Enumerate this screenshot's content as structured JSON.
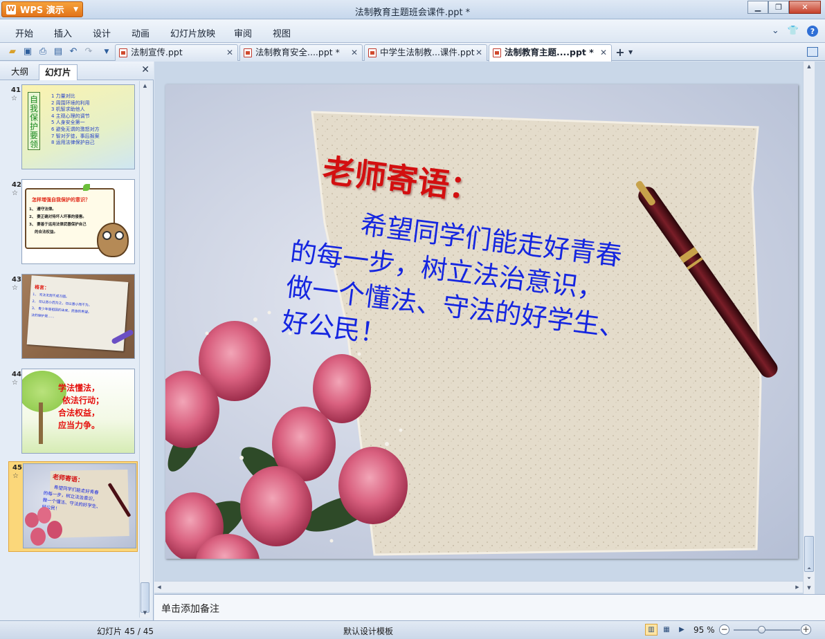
{
  "window": {
    "app_button": "WPS 演示",
    "title": "法制教育主题班会课件.ppt *"
  },
  "menu": [
    "开始",
    "插入",
    "设计",
    "动画",
    "幻灯片放映",
    "审阅",
    "视图"
  ],
  "tabs": [
    {
      "label": "法制宣传.ppt"
    },
    {
      "label": "法制教育安全....ppt *"
    },
    {
      "label": "中学生法制教...课件.ppt"
    },
    {
      "label": "法制教育主题....ppt *"
    }
  ],
  "left_pane": {
    "tab_outline": "大纲",
    "tab_slides": "幻灯片"
  },
  "slides": [
    {
      "number": "41",
      "title": "自我保护要领",
      "items": [
        "1 力量对比",
        "2 周围环境的利用",
        "3 机智求助他人",
        "4 主观心理的调节",
        "5 人身安全第一",
        "6 避免无谓的激怒对方",
        "7 智对歹徒，事后报案",
        "8 运用法律保护自己"
      ]
    },
    {
      "number": "42",
      "title": "怎样增强自我保护的意识？",
      "items": [
        "1、 遵守法律。",
        "2、 要正确对待坏人坏事的侵害。",
        "3、 要善于运用法律武器保护自己",
        "的合法权益。"
      ]
    },
    {
      "number": "43",
      "title": "格言：",
      "items": [
        "1、 无法无规不成方圆。",
        "2、 勿以恶小而为之，勿以善小而不为。",
        "3、 青少年是祖国的未来，民族的希望。",
        "法的保护是……"
      ]
    },
    {
      "number": "44",
      "lines": [
        "学法懂法，",
        "依法行动；",
        "合法权益，",
        "应当力争。"
      ]
    },
    {
      "number": "45",
      "heading": "老师寄语：",
      "body_lines": [
        "希望同学们能走好青春",
        "的每一步，树立法治意识，",
        "做一个懂法、守法的好学生、",
        "好公民！"
      ]
    }
  ],
  "notes_placeholder": "单击添加备注",
  "status": {
    "slide_counter": "幻灯片 45 / 45",
    "template": "默认设计模板",
    "zoom": "95 %",
    "zoom_fraction": 0.42
  },
  "colors": {
    "heading_red": "#d30f10",
    "body_blue": "#1526e0",
    "wps_orange": "#e2731a"
  }
}
